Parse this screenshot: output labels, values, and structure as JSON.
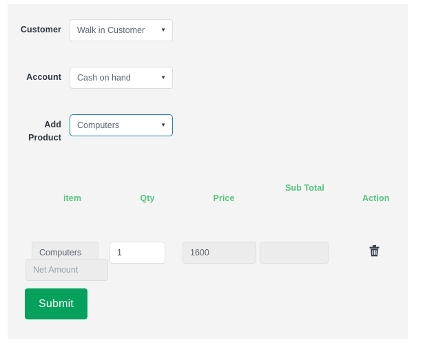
{
  "theme": {
    "panel_bg": "#f4f4f4",
    "page_bg": "#ffffff",
    "header_green": "#55c57f",
    "submit_green": "#06a15c",
    "focus_blue": "#2080a8",
    "label_color": "#2f3640",
    "disabled_bg": "#ececec"
  },
  "form": {
    "fields": [
      {
        "label": "Customer",
        "name": "customer",
        "value": "Walk in Customer",
        "caret": "caret-down-icon",
        "focused": false
      },
      {
        "label": "Account",
        "name": "account",
        "value": "Cash on hand",
        "caret": "caret-down-icon",
        "focused": false
      },
      {
        "label": "Add Product",
        "name": "add-product",
        "value": "Computers",
        "caret": "caret-down-icon",
        "focused": true
      }
    ]
  },
  "items_table": {
    "headers": [
      "item",
      "Qty",
      "Price",
      "Sub Total",
      "Action"
    ],
    "rows": [
      {
        "item": "Computers",
        "qty": "1",
        "price": "1600",
        "sub_total": "",
        "action_icon": "trash-icon"
      }
    ]
  },
  "footer": {
    "net_amount_value": "",
    "net_amount_placeholder": "Net Amount",
    "submit_label": "Submit"
  }
}
